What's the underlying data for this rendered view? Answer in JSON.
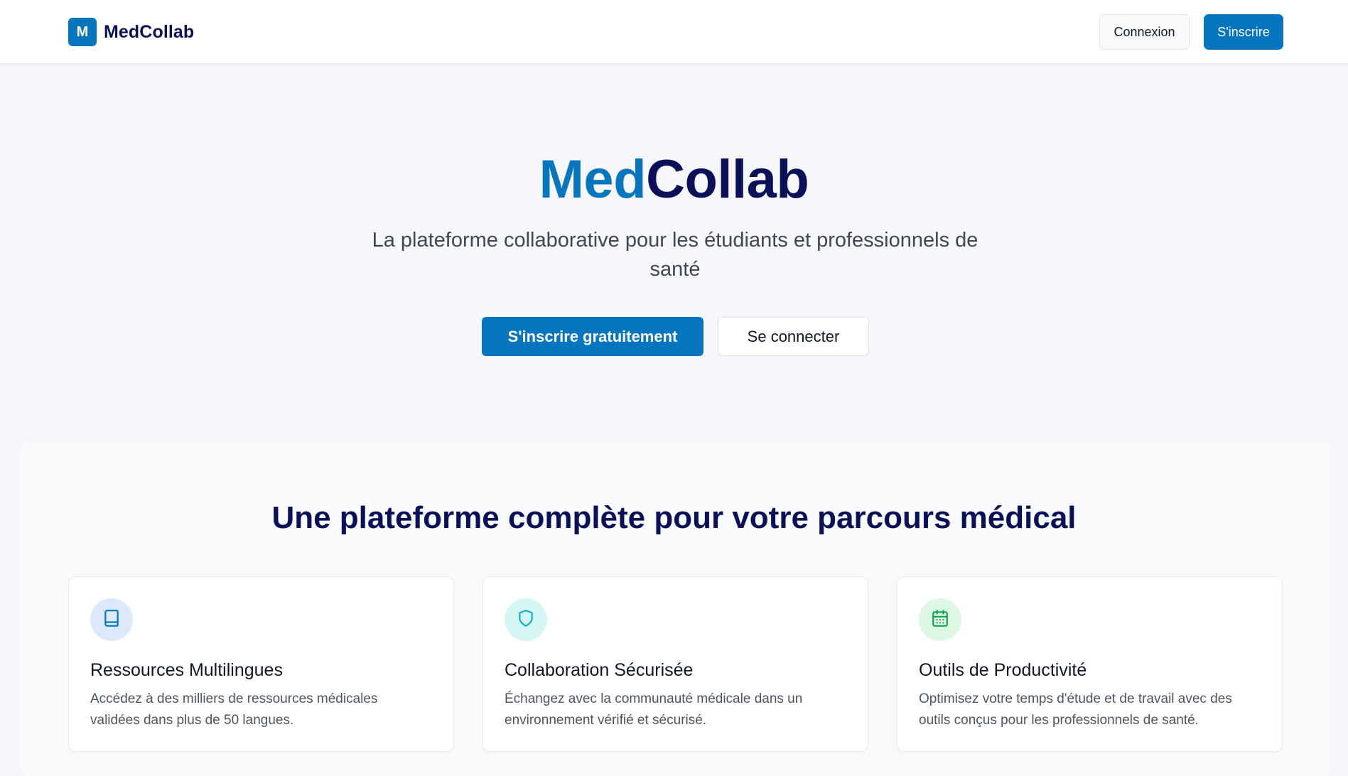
{
  "header": {
    "brand_letter": "M",
    "brand_name": "MedCollab",
    "login_label": "Connexion",
    "signup_label": "S'inscrire"
  },
  "hero": {
    "title_part1": "Med",
    "title_part2": "Collab",
    "subtitle": "La plateforme collaborative pour les étudiants et professionnels de santé",
    "cta_primary": "S'inscrire gratuitement",
    "cta_secondary": "Se connecter"
  },
  "features": {
    "title": "Une plateforme complète pour votre parcours médical",
    "cards": [
      {
        "icon": "book-icon",
        "title": "Ressources Multilingues",
        "text": "Accédez à des milliers de ressources médicales validées dans plus de 50 langues.",
        "icon_color": "#0876bf",
        "icon_bg": "#dbe9fb"
      },
      {
        "icon": "shield-icon",
        "title": "Collaboration Sécurisée",
        "text": "Échangez avec la communauté médicale dans un environnement vérifié et sécurisé.",
        "icon_color": "#0ab3c9",
        "icon_bg": "#d5f6f4"
      },
      {
        "icon": "calendar-icon",
        "title": "Outils de Productivité",
        "text": "Optimisez votre temps d'étude et de travail avec des outils conçus pour les professionnels de santé.",
        "icon_color": "#16a34a",
        "icon_bg": "#dcf7e4"
      }
    ]
  },
  "colors": {
    "primary": "#0876bf",
    "navy": "#0b1159",
    "background": "#f5f7fa"
  }
}
